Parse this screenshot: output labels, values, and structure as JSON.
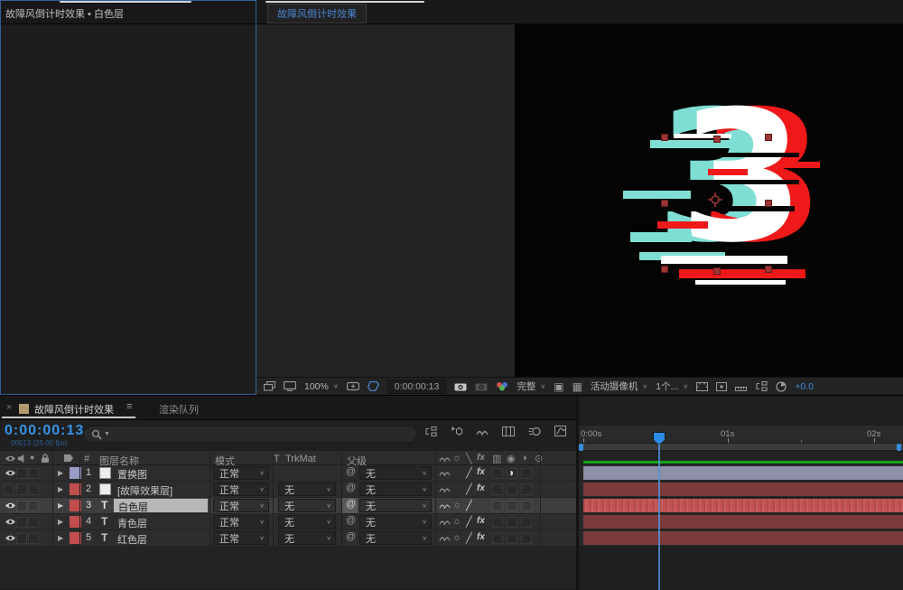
{
  "effect_controls": {
    "tab_label": "故障风倒计时效果 • 白色层"
  },
  "viewer": {
    "tab_label": "故障风倒计时效果",
    "digit": "3",
    "toolbar": {
      "zoom_level": "100%",
      "timecode": "0:00:00:13",
      "resolution": "完整",
      "camera_view": "活动摄像机",
      "view_layout": "1个...",
      "exposure": "+0.0"
    }
  },
  "timeline": {
    "tab_comp": "故障风倒计时效果",
    "tab_render_queue": "渲染队列",
    "timecode": "0:00:00:13",
    "frame_info": "00013 (25.00 fps)",
    "columns": {
      "hash": "#",
      "layer_name": "图层名称",
      "mode": "模式",
      "t": "T",
      "trkmat": "TrkMat",
      "parent": "父级"
    },
    "ruler_labels": [
      "0:00s",
      "01s",
      "02s"
    ],
    "none_label": "无",
    "layers": [
      {
        "num": "1",
        "name": "置换图",
        "mode": "正常",
        "trkmat": "",
        "parent": "无",
        "label_color": "#9a9cc8",
        "bar_color": "#8d90a7"
      },
      {
        "num": "2",
        "name": "[故障效果层]",
        "mode": "正常",
        "trkmat": "无",
        "parent": "无",
        "label_color": "#c14d4d",
        "bar_color": "#7b3b3b"
      },
      {
        "num": "3",
        "name": "白色层",
        "mode": "正常",
        "trkmat": "无",
        "parent": "无",
        "label_color": "#c14d4d",
        "bar_color": "#c25252"
      },
      {
        "num": "4",
        "name": "青色层",
        "mode": "正常",
        "trkmat": "无",
        "parent": "无",
        "label_color": "#c14d4d",
        "bar_color": "#7b3b3b"
      },
      {
        "num": "5",
        "name": "红色层",
        "mode": "正常",
        "trkmat": "无",
        "parent": "无",
        "label_color": "#c14d4d",
        "bar_color": "#7b3b3b"
      }
    ]
  },
  "colors": {
    "accent_blue": "#3b8de0",
    "render_green": "#17a217",
    "handle_red": "#9e3434"
  }
}
